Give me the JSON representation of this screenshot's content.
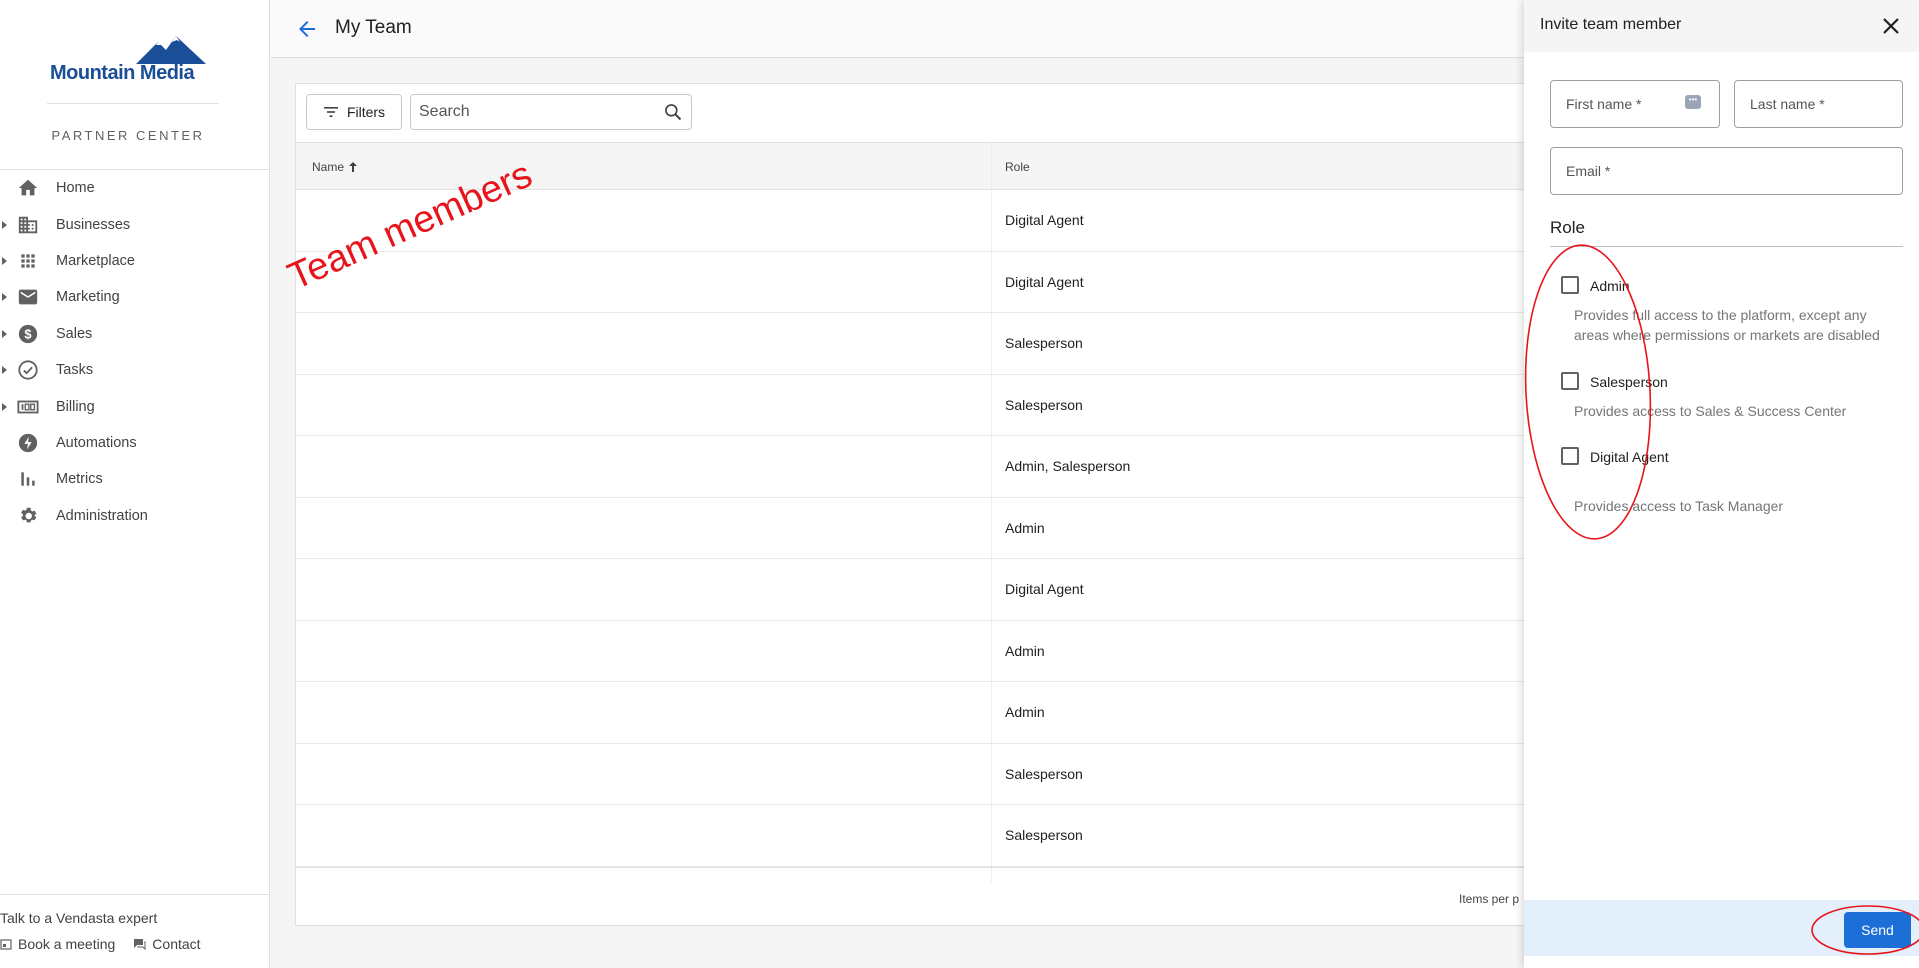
{
  "brand": {
    "name": "Mountain Media",
    "subtitle": "PARTNER CENTER",
    "color": "#1a4e96"
  },
  "sidebar": {
    "items": [
      {
        "label": "Home",
        "icon": "home-icon",
        "expandable": false
      },
      {
        "label": "Businesses",
        "icon": "building-icon",
        "expandable": true
      },
      {
        "label": "Marketplace",
        "icon": "apps-grid-icon",
        "expandable": true
      },
      {
        "label": "Marketing",
        "icon": "mail-icon",
        "expandable": true
      },
      {
        "label": "Sales",
        "icon": "dollar-icon",
        "expandable": true
      },
      {
        "label": "Tasks",
        "icon": "check-circle-icon",
        "expandable": true
      },
      {
        "label": "Billing",
        "icon": "billing-icon",
        "expandable": true
      },
      {
        "label": "Automations",
        "icon": "bolt-icon",
        "expandable": false
      },
      {
        "label": "Metrics",
        "icon": "bar-chart-icon",
        "expandable": false
      },
      {
        "label": "Administration",
        "icon": "gear-icon",
        "expandable": false
      }
    ],
    "footer": {
      "talk": "Talk to a Vendasta expert",
      "book": "Book a meeting",
      "contact": "Contact"
    }
  },
  "header": {
    "title": "My Team"
  },
  "toolbar": {
    "filters_label": "Filters",
    "search_placeholder": "Search"
  },
  "table": {
    "columns": {
      "name": "Name",
      "role": "Role"
    },
    "rows": [
      {
        "role": "Digital Agent"
      },
      {
        "role": "Digital Agent"
      },
      {
        "role": "Salesperson"
      },
      {
        "role": "Salesperson"
      },
      {
        "role": "Admin, Salesperson"
      },
      {
        "role": "Admin"
      },
      {
        "role": "Digital Agent"
      },
      {
        "role": "Admin"
      },
      {
        "role": "Admin"
      },
      {
        "role": "Salesperson"
      },
      {
        "role": "Salesperson"
      }
    ],
    "footer": {
      "items_per_page": "Items per p"
    }
  },
  "annotation": {
    "text": "Team members",
    "color": "#e8141b"
  },
  "drawer": {
    "title": "Invite team member",
    "first_name_placeholder": "First name *",
    "last_name_placeholder": "Last name *",
    "email_placeholder": "Email *",
    "role_title": "Role",
    "roles": [
      {
        "label": "Admin",
        "desc": "Provides full access to the platform, except any areas where permissions or markets are disabled",
        "checked": false
      },
      {
        "label": "Salesperson",
        "desc": "Provides access to Sales & Success Center",
        "checked": false
      },
      {
        "label": "Digital Agent",
        "desc": "Provides access to Task Manager",
        "checked": false
      }
    ],
    "send_label": "Send",
    "accent": "#1b6fd6"
  }
}
